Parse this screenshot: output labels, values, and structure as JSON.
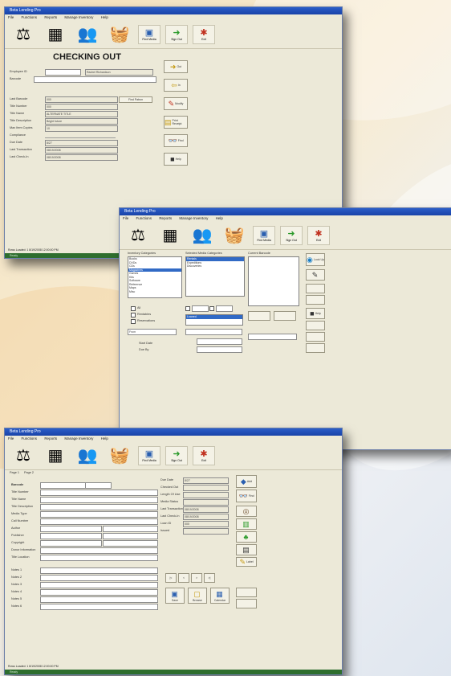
{
  "app": {
    "title": "Beta Lending Pro"
  },
  "menu": [
    "File",
    "Functions",
    "Reports",
    "Manage Inventory",
    "Help"
  ],
  "toolbar": {
    "items": [
      {
        "icon": "library-scale-icon",
        "glyph": "⚖"
      },
      {
        "icon": "cash-register-icon",
        "glyph": "▦"
      },
      {
        "icon": "people-icon",
        "glyph": "👥"
      },
      {
        "icon": "basket-icon",
        "glyph": "🧺"
      },
      {
        "icon": "monitor-icon",
        "glyph": "▣",
        "label": "Find Media"
      },
      {
        "icon": "green-arrow-icon",
        "glyph": "➜",
        "label": "Sign Out"
      },
      {
        "icon": "red-figure-icon",
        "glyph": "✱",
        "label": "Exit"
      }
    ]
  },
  "window1": {
    "heading": "CHECKING OUT",
    "fields": [
      {
        "label": "Employee ID",
        "value": "",
        "value2": "Rachel Richardson"
      },
      {
        "label": "Barcode",
        "value": ""
      },
      {
        "label": "Last Barcode",
        "value": "000"
      },
      {
        "label": "Title Number",
        "value": "000"
      },
      {
        "label": "Title Name",
        "value": "ALTERNATE TITLE"
      },
      {
        "label": "Title Description",
        "value": "Bright future"
      },
      {
        "label": "Max Item Copies",
        "value": "10"
      },
      {
        "label": "Compliance",
        "value": ""
      },
      {
        "label": "Due Date",
        "value": "8/27"
      },
      {
        "label": "Last Transaction",
        "value": "08/19/2008"
      },
      {
        "label": "Last Check-In",
        "value": "08/19/2008"
      }
    ],
    "side_button": "Find Patron",
    "buttons": [
      {
        "icon": "checkout-arrow-icon",
        "glyph": "➜",
        "label": "Out"
      },
      {
        "icon": "checkin-icon",
        "glyph": "⇦",
        "label": "In"
      },
      {
        "icon": "tools-icon",
        "glyph": "✎",
        "label": "Modify"
      },
      {
        "icon": "folder-print-icon",
        "glyph": "▤",
        "label": "Print Receipt"
      },
      {
        "icon": "binoculars-icon",
        "glyph": "👓",
        "label": "Find"
      },
      {
        "icon": "book-icon",
        "glyph": "■",
        "label": "Help"
      }
    ],
    "status": "Rows Loaded: 1   8/19/2008   12:00:00 PM",
    "status2": "Ready"
  },
  "window2": {
    "left_list_title": "Inventory Categories",
    "left_list": [
      "Books",
      "DVDs",
      "CDs",
      "Magazines",
      "Games",
      "Kits",
      "Software",
      "Reference",
      "Maps",
      "Misc"
    ],
    "mid_list_title": "Selected Media Categories",
    "mid_list": [
      "Rentals",
      "Expeditions",
      "Discoveries"
    ],
    "right_list_title": "Current Barcode",
    "options": [
      "All",
      "Rentables",
      "Reservations"
    ],
    "filter_label": "From",
    "filter_value": "",
    "lower_labels": [
      "Start Date",
      "Due By",
      "Loaned"
    ],
    "buttons": [
      {
        "icon": "lookup-icon",
        "glyph": "◉",
        "label": "Look Up"
      },
      {
        "icon": "note-icon",
        "glyph": "✎",
        "label": ""
      },
      {
        "icon": "book2-icon",
        "glyph": "■",
        "label": "Help"
      }
    ],
    "status": "",
    "status2": ""
  },
  "window3": {
    "tabs": [
      "Page 1",
      "Page 2"
    ],
    "left_fields": [
      "Barcode",
      "Title Number",
      "Title Name",
      "Title Description",
      "Media Type",
      "Call Number",
      "Author",
      "Publisher",
      "Copyright",
      "Donor Information",
      "Title Location"
    ],
    "lower_labels": [
      "Notes 1",
      "Notes 2",
      "Notes 3",
      "Notes 4",
      "Notes 5",
      "Notes 6"
    ],
    "right_fields": [
      {
        "label": "Due Date",
        "value": "8/27"
      },
      {
        "label": "Checked Out",
        "value": ""
      },
      {
        "label": "Length Of Use",
        "value": ""
      },
      {
        "label": "Media Status",
        "value": ""
      },
      {
        "label": "Last Transaction",
        "value": "08/19/2008"
      },
      {
        "label": "Last Check-In",
        "value": "08/19/2008"
      },
      {
        "label": "Loan ID",
        "value": "000"
      },
      {
        "label": "Issued",
        "value": ""
      }
    ],
    "buttons": [
      {
        "icon": "add-icon",
        "glyph": "◆",
        "label": "Add"
      },
      {
        "icon": "binoculars2-icon",
        "glyph": "👓",
        "label": "Find"
      },
      {
        "icon": "eye-icon",
        "glyph": "◎",
        "label": ""
      },
      {
        "icon": "green-book-icon",
        "glyph": "▥",
        "label": ""
      },
      {
        "icon": "map-icon",
        "glyph": "♣",
        "label": ""
      },
      {
        "icon": "doc-icon",
        "glyph": "▤",
        "label": ""
      },
      {
        "icon": "pencil-icon",
        "glyph": "✎",
        "label": "Label"
      }
    ],
    "bottom_buttons": [
      {
        "icon": "save-icon",
        "glyph": "▣",
        "label": "Save"
      },
      {
        "icon": "folder-icon",
        "glyph": "▢",
        "label": "Browse"
      },
      {
        "icon": "calendar-icon",
        "glyph": "▦",
        "label": "Calendar"
      }
    ],
    "nav": [
      "|<",
      "<",
      ">",
      ">|"
    ],
    "status": "Rows Loaded: 1   8/19/2008   12:00:00 PM",
    "status2": "Ready"
  }
}
